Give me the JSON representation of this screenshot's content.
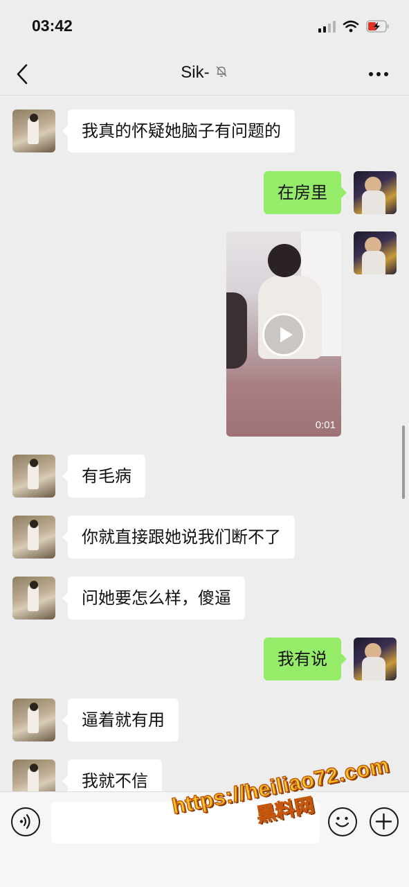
{
  "status_bar": {
    "time": "03:42"
  },
  "header": {
    "title": "Sik-",
    "back_icon": "chevron-left-icon",
    "mute_icon": "bell-off-icon",
    "more_icon": "more-horizontal-icon"
  },
  "messages": [
    {
      "side": "left",
      "type": "text",
      "text": "我真的怀疑她脑子有问题的"
    },
    {
      "side": "right",
      "type": "text",
      "text": "在房里"
    },
    {
      "side": "right",
      "type": "video",
      "duration": "0:01"
    },
    {
      "side": "left",
      "type": "text",
      "text": "有毛病"
    },
    {
      "side": "left",
      "type": "text",
      "text": "你就直接跟她说我们断不了"
    },
    {
      "side": "left",
      "type": "text",
      "text": "问她要怎么样，傻逼"
    },
    {
      "side": "right",
      "type": "text",
      "text": "我有说"
    },
    {
      "side": "left",
      "type": "text",
      "text": "逼着就有用"
    },
    {
      "side": "left",
      "type": "text",
      "text": "我就不信"
    }
  ],
  "input_bar": {
    "value": "",
    "voice_icon": "voice-icon",
    "emoji_icon": "emoji-icon",
    "plus_icon": "plus-icon"
  },
  "watermark": {
    "url": "https://heiliao72.com",
    "name": "黑料网"
  },
  "colors": {
    "background": "#ededed",
    "bubble_self": "#95ec69",
    "bubble_other": "#ffffff"
  }
}
